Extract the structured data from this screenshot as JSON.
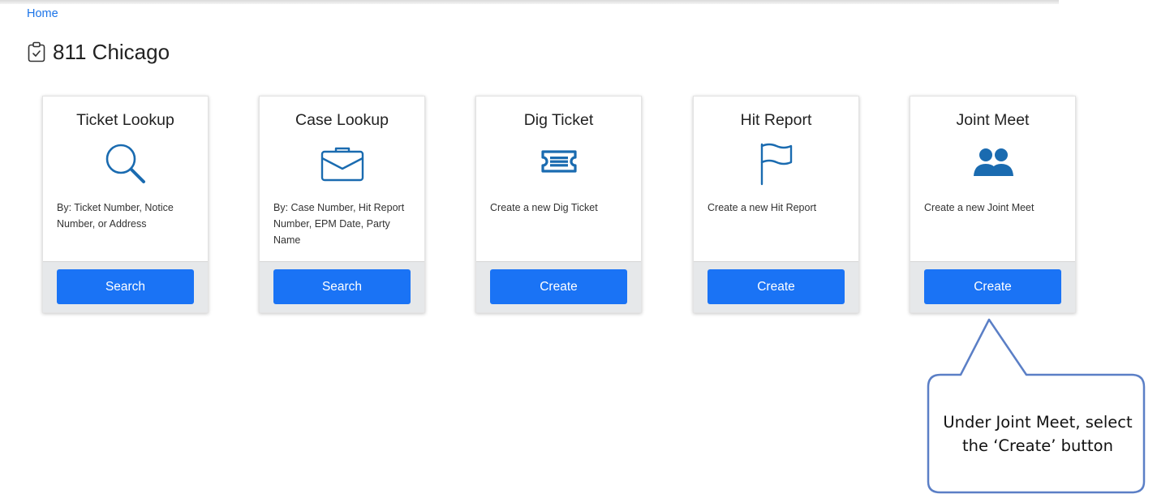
{
  "breadcrumb": {
    "home": "Home"
  },
  "page": {
    "title": "811 Chicago",
    "title_icon": "clipboard-check-icon"
  },
  "colors": {
    "accent": "#1a73f5",
    "icon": "#1a6bb0",
    "link": "#1a73e8",
    "callout_border": "#5b7fc6"
  },
  "cards": [
    {
      "title": "Ticket Lookup",
      "icon": "search-icon",
      "description": "By: Ticket Number, Notice Number, or Address",
      "button": "Search"
    },
    {
      "title": "Case Lookup",
      "icon": "briefcase-icon",
      "description": "By: Case Number, Hit Report Number, EPM Date, Party Name",
      "button": "Search"
    },
    {
      "title": "Dig Ticket",
      "icon": "ticket-icon",
      "description": "Create a new Dig Ticket",
      "button": "Create"
    },
    {
      "title": "Hit Report",
      "icon": "flag-icon",
      "description": "Create a new Hit Report",
      "button": "Create"
    },
    {
      "title": "Joint Meet",
      "icon": "users-icon",
      "description": "Create a new Joint Meet",
      "button": "Create"
    }
  ],
  "callout": {
    "text": "Under Joint Meet, select the ‘Create’ button"
  }
}
